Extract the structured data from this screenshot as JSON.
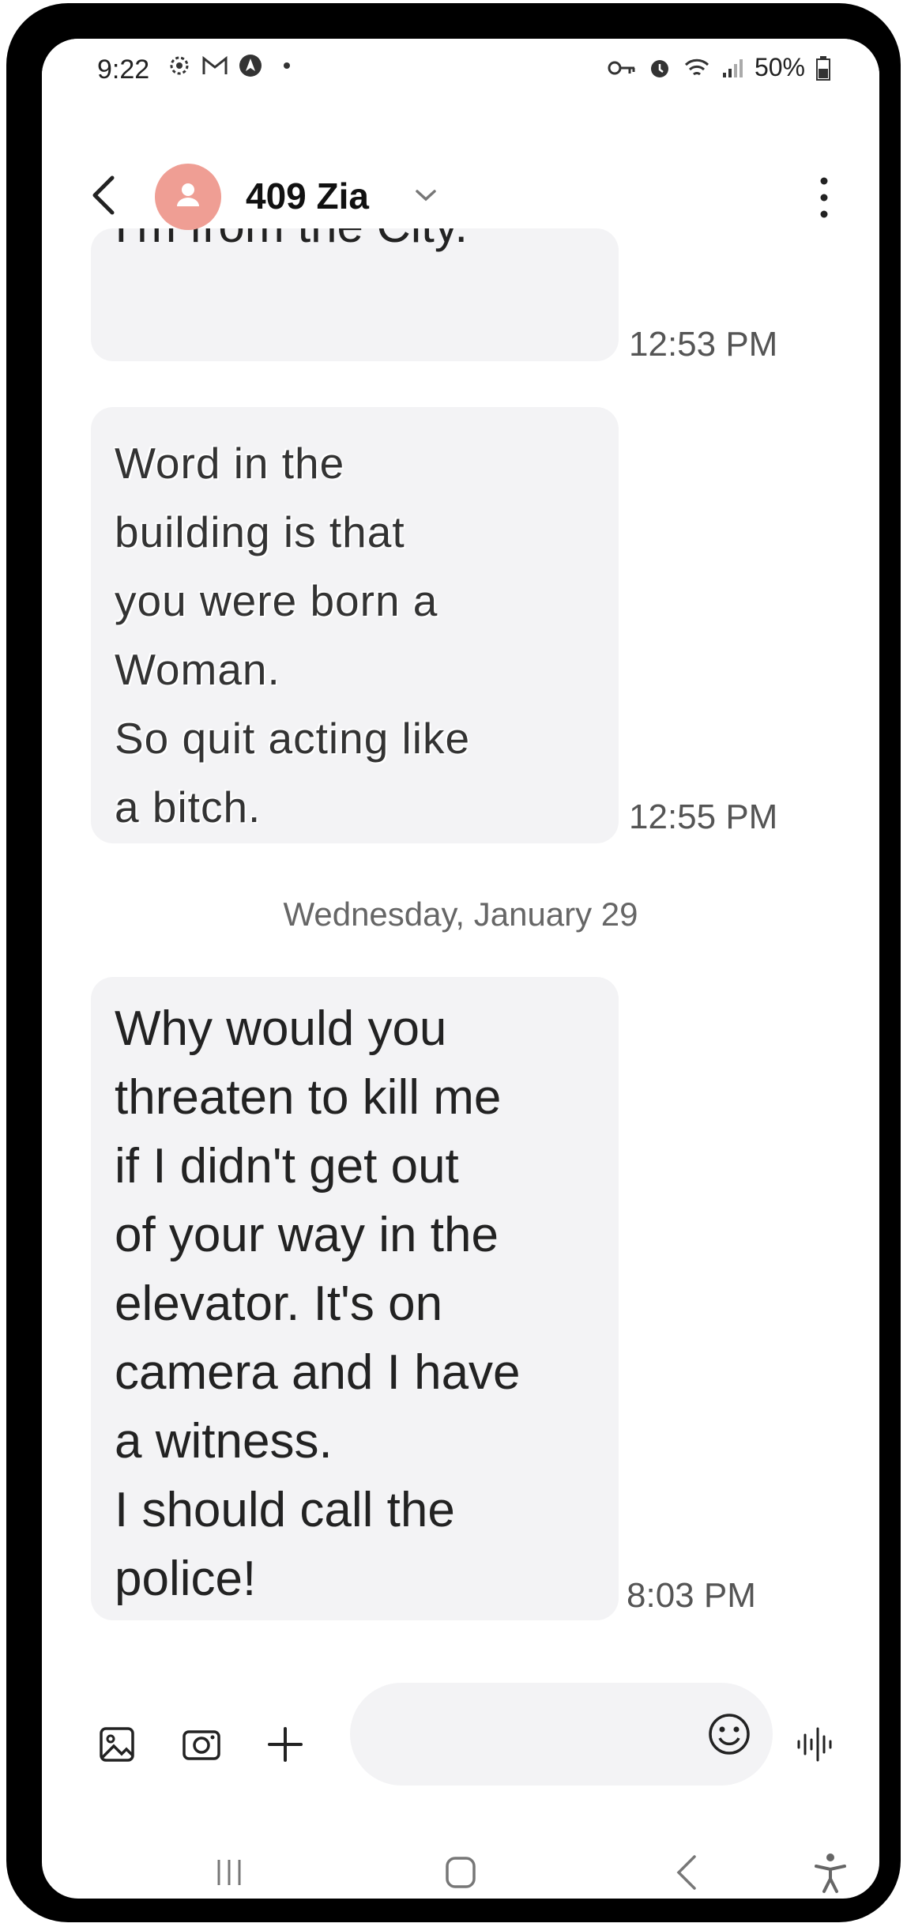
{
  "status_bar": {
    "time": "9:22",
    "battery": "50%"
  },
  "header": {
    "contact_name": "409 Zia"
  },
  "messages": [
    {
      "text": "I'm from the City.",
      "time": "12:53 PM"
    },
    {
      "text": "Word in the\nbuilding is that\nyou were born a\nWoman.\nSo quit acting like\na bitch.",
      "time": "12:55 PM"
    },
    {
      "text": "Why would you\nthreaten to kill me\nif I didn't get out\nof your way in the\nelevator. It's on\ncamera and I have\na witness.\nI should call the\npolice!",
      "time": "8:03 PM"
    }
  ],
  "date_separator": "Wednesday, January 29",
  "colors": {
    "avatar": "#ef9e94",
    "bubble": "#f3f3f5"
  }
}
